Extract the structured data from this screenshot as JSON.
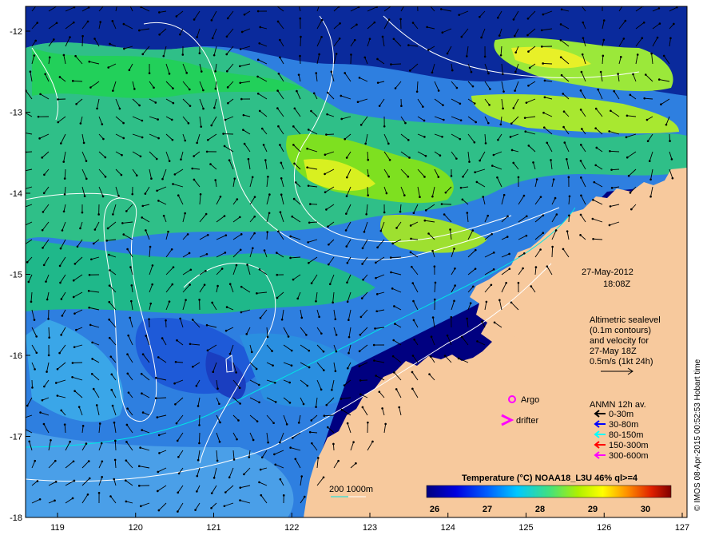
{
  "map": {
    "lon_ticks": [
      "119",
      "120",
      "121",
      "122",
      "123",
      "124",
      "125",
      "126",
      "127"
    ],
    "lat_ticks": [
      "-12",
      "-13",
      "-14",
      "-15",
      "-16",
      "-17",
      "-18"
    ],
    "date": "27-May-2012",
    "time": "18:08Z",
    "altimetry_note": [
      "Altimetric sealevel",
      "(0.1m contours)",
      "and velocity for",
      "27-May 18Z",
      "0.5m/s (1kt 24h)"
    ],
    "argo_label": "Argo",
    "drifter_label": "drifter",
    "anmn_title": "ANMN 12h av.",
    "anmn_items": [
      {
        "label": "0-30m",
        "color": "#000000"
      },
      {
        "label": "30-80m",
        "color": "#0000ff"
      },
      {
        "label": "80-150m",
        "color": "#00ffff"
      },
      {
        "label": "150-300m",
        "color": "#ff0000"
      },
      {
        "label": "300-600m",
        "color": "#ff00ff"
      }
    ],
    "bathy_label": "200  1000m",
    "colorbar_title": "Temperature (°C) NOAA18_L3U 46% ql>=4",
    "colorbar_ticks": [
      "26",
      "27",
      "28",
      "29",
      "30"
    ],
    "credit": "© IMOS 08-Apr-2015 00:52:53 Hobart time",
    "colors": {
      "land": "#f7c99d",
      "deep": "#000080",
      "argo": "#ff00ff",
      "drifter": "#ff00ff",
      "bathy200": "#00e5e5",
      "bathy1000": "#ffffff"
    }
  }
}
